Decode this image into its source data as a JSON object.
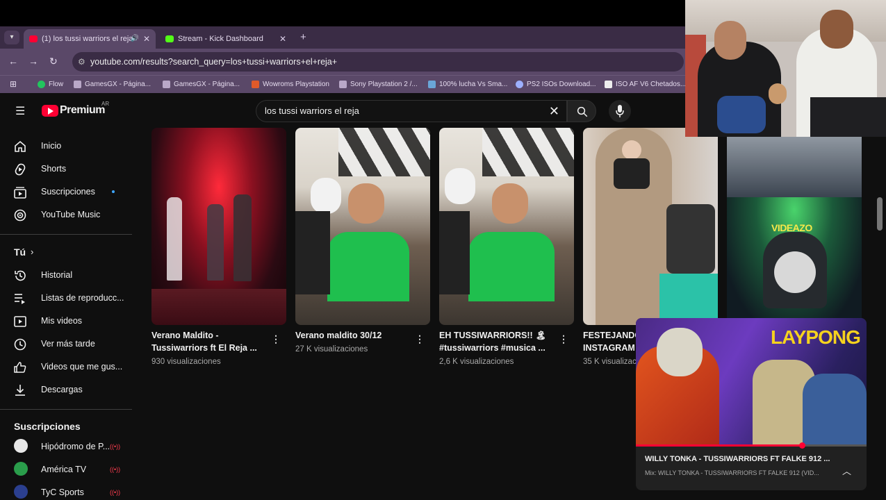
{
  "browser": {
    "tabs": [
      {
        "title": "(1) los tussi warriors el reja",
        "favicon_color": "#ff0033",
        "active": true
      },
      {
        "title": "Stream - Kick Dashboard",
        "favicon_color": "#53fc18",
        "active": false
      }
    ],
    "new_tab": "+",
    "url": "youtube.com/results?search_query=los+tussi+warriors+el+reja+",
    "bookmarks": [
      "Flow",
      "GamesGX - Página...",
      "GamesGX - Página...",
      "Wowroms Playstation",
      "Sony Playstation 2 /...",
      "100% lucha Vs Sma...",
      "PS2 ISOs Download...",
      "ISO AF V6 Chetados..."
    ]
  },
  "youtube": {
    "logo": "Premium",
    "region": "AR",
    "search_query": "los tussi warriors el reja",
    "brand_color": "#ff0033"
  },
  "sidebar": {
    "main": [
      {
        "label": "Inicio",
        "icon": "home-icon"
      },
      {
        "label": "Shorts",
        "icon": "shorts-icon"
      },
      {
        "label": "Suscripciones",
        "icon": "subscriptions-icon",
        "dot": true
      },
      {
        "label": "YouTube Music",
        "icon": "music-icon"
      }
    ],
    "you_heading": "Tú",
    "you": [
      {
        "label": "Historial",
        "icon": "history-icon"
      },
      {
        "label": "Listas de reproducc...",
        "icon": "playlist-icon"
      },
      {
        "label": "Mis videos",
        "icon": "my-videos-icon"
      },
      {
        "label": "Ver más tarde",
        "icon": "watch-later-icon"
      },
      {
        "label": "Videos que me gus...",
        "icon": "like-icon"
      },
      {
        "label": "Descargas",
        "icon": "download-icon"
      }
    ],
    "subs_heading": "Suscripciones",
    "subscriptions": [
      {
        "label": "Hipódromo de P...",
        "color": "#e8e8e8"
      },
      {
        "label": "América TV",
        "color": "#2a9d4b"
      },
      {
        "label": "TyC Sports",
        "color": "#2b3f8f"
      }
    ]
  },
  "results": [
    {
      "title": "Verano Maldito - Tussiwarriors ft El Reja ...",
      "views": "930 visualizaciones"
    },
    {
      "title": "Verano maldito 30/12",
      "views": "27 K visualizaciones"
    },
    {
      "title": "EH TUSSIWARRIORS!! 🏝 #tussiwarriors #musica ...",
      "views": "2,6 K visualizaciones"
    },
    {
      "title": "FESTEJANDO INSTAGRAM",
      "views": "35 K visualizaciones"
    }
  ],
  "fifth_thumb_caption": "VIDEAZO",
  "miniplayer": {
    "title": "WILLY TONKA - TUSSIWARRIORS FT FALKE 912 ...",
    "subtitle": "Mix: WILLY TONKA - TUSSIWARRIORS FT FALKE 912 (VID...",
    "video_caption": "LAYPONG",
    "progress": 0.72
  }
}
